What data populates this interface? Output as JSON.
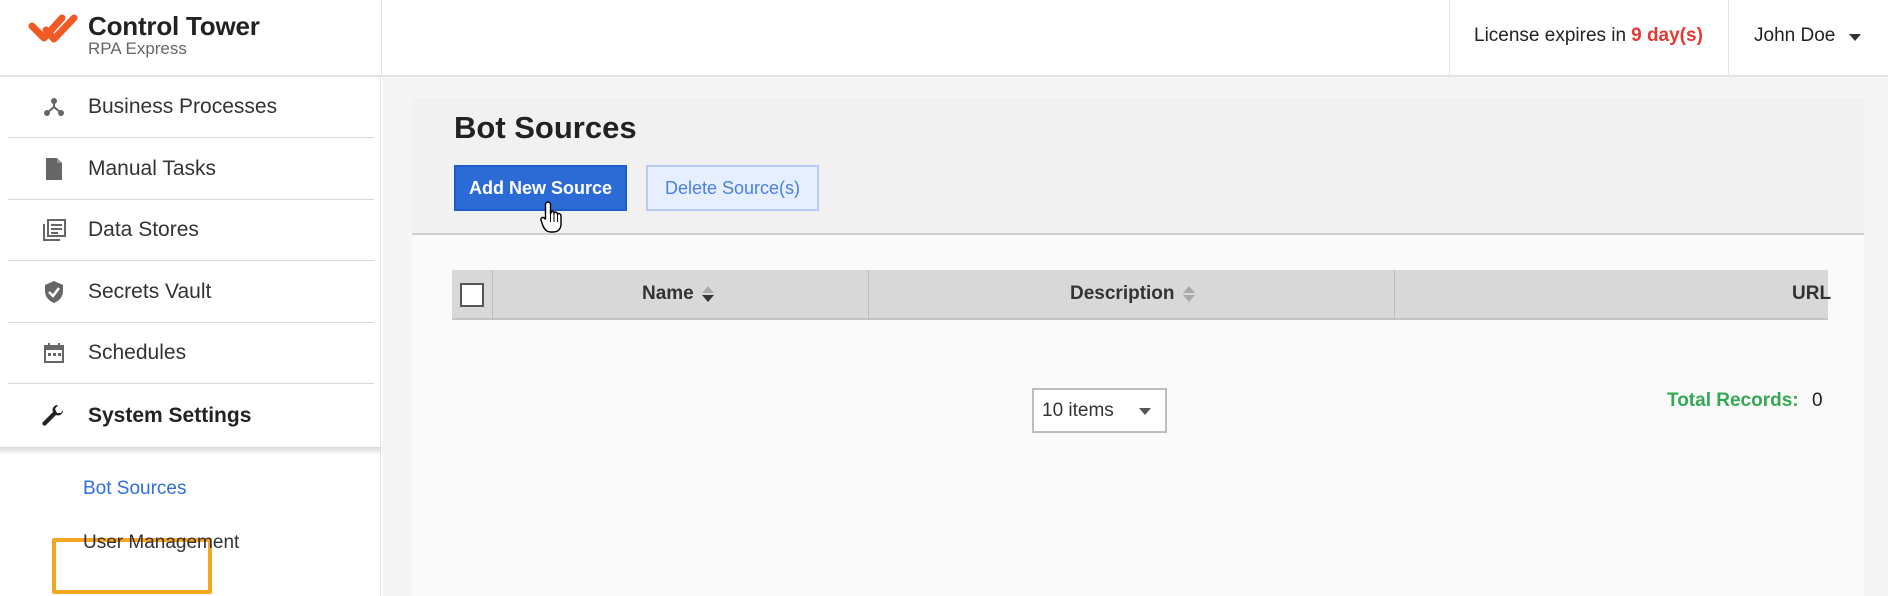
{
  "header": {
    "app_title": "Control Tower",
    "app_subtitle": "RPA Express",
    "license_prefix": "License expires in",
    "license_days": "9 day(s)",
    "user_name": "John Doe"
  },
  "sidebar": {
    "items": [
      {
        "label": "Business Processes",
        "icon": "process-tree-icon"
      },
      {
        "label": "Manual Tasks",
        "icon": "document-icon"
      },
      {
        "label": "Data Stores",
        "icon": "stack-icon"
      },
      {
        "label": "Secrets Vault",
        "icon": "shield-check-icon"
      },
      {
        "label": "Schedules",
        "icon": "calendar-icon"
      },
      {
        "label": "System Settings",
        "icon": "wrench-icon"
      }
    ],
    "subitems": [
      {
        "label": "Bot Sources"
      },
      {
        "label": "User Management"
      }
    ]
  },
  "main": {
    "title": "Bot Sources",
    "add_button": "Add New Source",
    "delete_button": "Delete Source(s)",
    "columns": [
      "Name",
      "Description",
      "URL"
    ],
    "page_size": "10 items",
    "total_label": "Total Records:",
    "total_value": "0"
  },
  "colors": {
    "primary": "#2c6bd6",
    "license_warning": "#e53935",
    "total_green": "#34a853",
    "highlight": "#f5a623",
    "logo": "#f15a24"
  }
}
